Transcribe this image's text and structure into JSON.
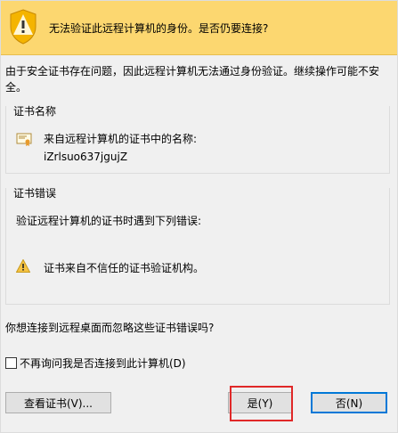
{
  "header": {
    "title": "无法验证此远程计算机的身份。是否仍要连接?",
    "icon": "warning-shield-icon"
  },
  "intro": "由于安全证书存在问题，因此远程计算机无法通过身份验证。继续操作可能不安全。",
  "cert_name_group": {
    "title": "证书名称",
    "label": "来自远程计算机的证书中的名称:",
    "value": "iZrlsuo637jgujZ",
    "icon": "certificate-icon"
  },
  "cert_error_group": {
    "title": "证书错误",
    "label": "验证远程计算机的证书时遇到下列错误:",
    "error": "证书来自不信任的证书验证机构。",
    "icon": "warning-icon"
  },
  "question": "你想连接到远程桌面而忽略这些证书错误吗?",
  "checkbox": {
    "label": "不再询问我是否连接到此计算机(D)",
    "checked": false
  },
  "buttons": {
    "view_cert": "查看证书(V)...",
    "yes": "是(Y)",
    "no": "否(N)"
  },
  "colors": {
    "header_bg": "#fcd770",
    "highlight": "#e02828",
    "focus": "#0078d7"
  }
}
